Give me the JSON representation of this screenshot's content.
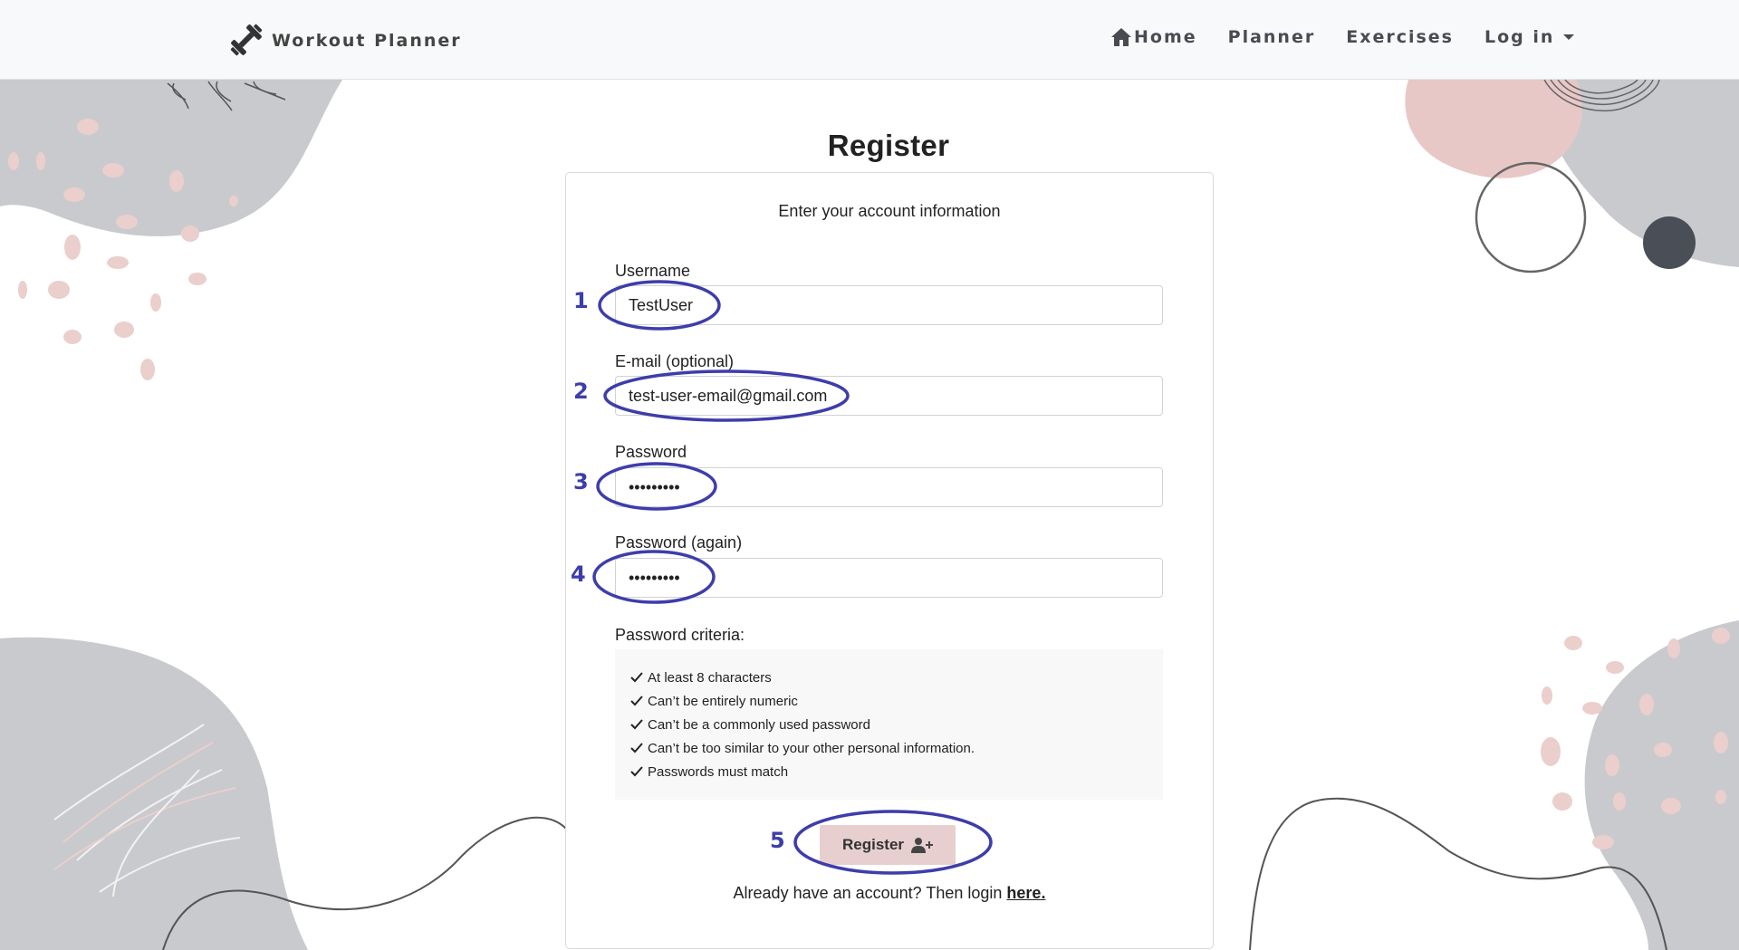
{
  "navbar": {
    "brand": "Workout Planner",
    "links": [
      {
        "label": "Home"
      },
      {
        "label": "Planner"
      },
      {
        "label": "Exercises"
      },
      {
        "label": "Log in"
      }
    ]
  },
  "page": {
    "title": "Register",
    "intro": "Enter your account information"
  },
  "form": {
    "username": {
      "label": "Username",
      "value": "TestUser"
    },
    "email": {
      "label": "E-mail (optional)",
      "value": "test-user-email@gmail.com"
    },
    "password": {
      "label": "Password",
      "value": "•••••••••"
    },
    "password_again": {
      "label": "Password (again)",
      "value": "•••••••••"
    }
  },
  "criteria": {
    "label": "Password criteria:",
    "items": [
      "At least 8 characters",
      "Can’t be entirely numeric",
      "Can’t be a commonly used password",
      "Can’t be too similar to your other personal information.",
      "Passwords must match"
    ]
  },
  "register_button": {
    "label": "Register",
    "icon": "user-plus-icon"
  },
  "login_prompt": {
    "text": "Already have an account? Then login ",
    "link": "here."
  },
  "annotations": [
    "1",
    "2",
    "3",
    "4",
    "5"
  ],
  "colors": {
    "annotation": "#3d3dab",
    "button_bg": "#e8cfcf",
    "decor_gray": "#c9cacd",
    "decor_pink": "#ebcfcc",
    "navbar_bg": "#f8f9fa"
  }
}
